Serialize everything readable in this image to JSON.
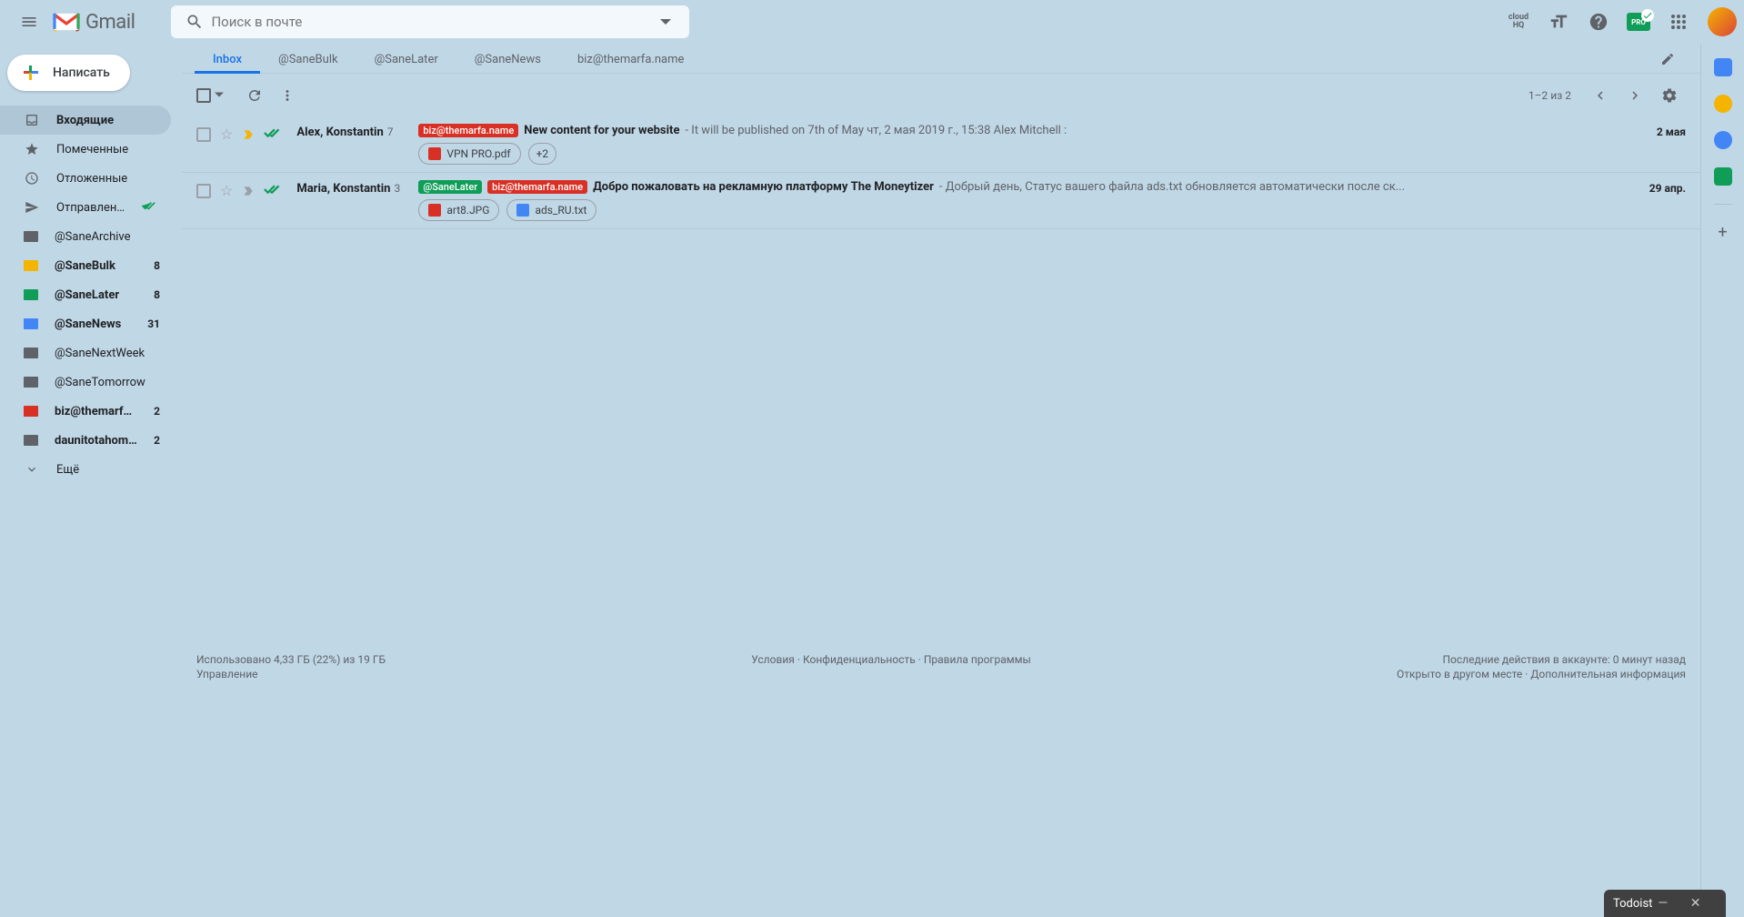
{
  "header": {
    "logo_text": "Gmail",
    "search_placeholder": "Поиск в почте",
    "cloudhq_l1": "cloud",
    "cloudhq_l2": "HQ",
    "pro_badge": "PRO"
  },
  "compose_label": "Написать",
  "sidebar": [
    {
      "icon": "inbox",
      "label": "Входящие",
      "count": "",
      "active": true,
      "bold": true
    },
    {
      "icon": "star",
      "label": "Помеченные",
      "count": ""
    },
    {
      "icon": "clock",
      "label": "Отложенные",
      "count": ""
    },
    {
      "icon": "sent",
      "label": "Отправленные",
      "count": "",
      "sent_check": true
    },
    {
      "icon": "folder",
      "label": "@SaneArchive",
      "count": "",
      "color": "#5f6368"
    },
    {
      "icon": "folder",
      "label": "@SaneBulk",
      "count": "8",
      "color": "#f4b400",
      "bold": true
    },
    {
      "icon": "folder",
      "label": "@SaneLater",
      "count": "8",
      "color": "#0f9d58",
      "bold": true
    },
    {
      "icon": "folder",
      "label": "@SaneNews",
      "count": "31",
      "color": "#4285f4",
      "bold": true
    },
    {
      "icon": "folder",
      "label": "@SaneNextWeek",
      "count": "",
      "color": "#5f6368"
    },
    {
      "icon": "folder",
      "label": "@SaneTomorrow",
      "count": "",
      "color": "#5f6368"
    },
    {
      "icon": "folder",
      "label": "biz@themarfa.name",
      "count": "2",
      "color": "#d93025",
      "bold": true
    },
    {
      "icon": "folder",
      "label": "daunitotahomas@m...",
      "count": "2",
      "color": "#5f6368",
      "bold": true
    },
    {
      "icon": "expand",
      "label": "Ещё",
      "count": ""
    }
  ],
  "tabs": [
    "Inbox",
    "@SaneBulk",
    "@SaneLater",
    "@SaneNews",
    "biz@themarfa.name"
  ],
  "toolbar": {
    "page_info": "1–2 из 2"
  },
  "emails": [
    {
      "important_color": "#f4b400",
      "sender": "Alex, Konstantin",
      "sender_count": "7",
      "labels": [
        {
          "text": "biz@themarfa.name",
          "cls": "lbl-red"
        }
      ],
      "subject": "New content for your website",
      "preview": " - It will be published on 7th of May чт, 2 мая 2019 г., 15:38 Alex Mitchell <alex@vpnpro.press>:",
      "date": "2 мая",
      "attachments": [
        {
          "icon": "ai-pdf",
          "name": "VPN PRO.pdf"
        },
        {
          "icon": "",
          "name": "+2",
          "more": true
        }
      ]
    },
    {
      "important_color": "#9aa0a6",
      "sender": "Maria, Konstantin",
      "sender_count": "3",
      "labels": [
        {
          "text": "@SaneLater",
          "cls": "lbl-green"
        },
        {
          "text": "biz@themarfa.name",
          "cls": "lbl-red"
        }
      ],
      "subject": "Добро пожаловать на рекламную платформу The Moneytizer",
      "preview": " - Добрый день, Статус вашего файла ads.txt обновляется автоматически после ск...",
      "date": "29 апр.",
      "attachments": [
        {
          "icon": "ai-img",
          "name": "art8.JPG"
        },
        {
          "icon": "ai-txt",
          "name": "ads_RU.txt"
        }
      ]
    }
  ],
  "footer": {
    "storage": "Использовано 4,33 ГБ (22%) из 19 ГБ",
    "manage": "Управление",
    "terms": "Условия",
    "privacy": "Конфиденциальность",
    "program": "Правила программы",
    "activity": "Последние действия в аккаунте: 0 минут назад",
    "open_elsewhere": "Открыто в другом месте",
    "details": "Дополнительная информация"
  },
  "todoist": "Todoist"
}
